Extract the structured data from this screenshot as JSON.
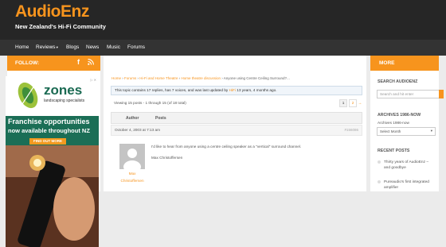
{
  "site": {
    "logo": "AudioEnz",
    "tagline": "New Zealand's Hi-Fi Community"
  },
  "nav": {
    "items": [
      "Home",
      "Reviews",
      "Blogs",
      "News",
      "Music",
      "Forums"
    ],
    "reviews_caret": "▾"
  },
  "sidebar_left": {
    "follow_label": "FOLLOW:",
    "fb_icon": "f",
    "ad": {
      "brand": "zones",
      "sub": "landscaping specialists",
      "line1": "Franchise opportunities",
      "line2": "now available throughout NZ",
      "button": "FIND OUT MORE",
      "ad_mark": "▷ ✕"
    }
  },
  "main": {
    "breadcrumb": {
      "home": "Home",
      "sep": " › ",
      "forums": "Forums",
      "hifi": "Hi-Fi and Home Theatre",
      "ht": "Home theatre discussion",
      "current": "Anyone using Centre Ceiling Surround?..."
    },
    "notice": {
      "part1": "This topic contains 17 replies, has 7 voices, and was last updated by ",
      "user": "HiFi",
      "part2": " 13 years, 4 months ago."
    },
    "viewing": "Viewing 15 posts - 1 through 15 (of 18 total)",
    "pages": [
      "1",
      "2",
      "→"
    ],
    "table": {
      "author": "Author",
      "posts": "Posts"
    },
    "post": {
      "date": "October 4, 2003 at 7:13 am",
      "number": "#156086",
      "text": "I'd like to hear from anyone using a centre ceiling speaker as a \"vertical\" surround channel.",
      "signature": "Max Christoffersen",
      "author_first": "Max",
      "author_last": "Christoffersen"
    }
  },
  "sidebar_right": {
    "more_label": "MORE",
    "search_title": "SEARCH AUDIOENZ",
    "search_placeholder": "Search and hit enter",
    "archives_title": "ARCHIVES 1986-NOW",
    "archives_sub": "Archives 1986-now",
    "select_label": "Select Month",
    "select_caret": "▾",
    "recent_title": "RECENT POSTS",
    "recent_posts": [
      "Thirty years of AudioEnz –",
      "and goodbye",
      "Pureaudio's first integrated",
      "amplifier"
    ]
  },
  "colors": {
    "accent": "#f7941d",
    "header_bg": "#262626",
    "nav_bg": "#333333",
    "zones_green": "#1b6e56"
  }
}
